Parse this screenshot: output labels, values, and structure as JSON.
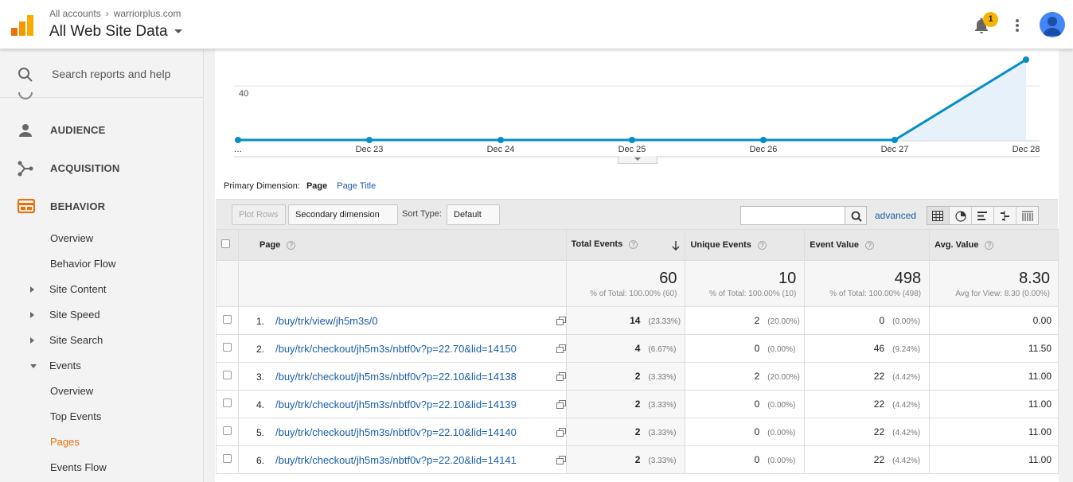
{
  "header": {
    "breadcrumb_root": "All accounts",
    "breadcrumb_account": "warriorplus.com",
    "view_title": "All Web Site Data",
    "notification_count": "1"
  },
  "sidebar": {
    "search_placeholder": "Search reports and help",
    "sections": [
      {
        "label": "AUDIENCE",
        "icon": "person-icon"
      },
      {
        "label": "ACQUISITION",
        "icon": "acquisition-icon"
      },
      {
        "label": "BEHAVIOR",
        "icon": "behavior-icon"
      }
    ],
    "behavior_items": [
      {
        "label": "Overview"
      },
      {
        "label": "Behavior Flow"
      },
      {
        "label": "Site Content"
      },
      {
        "label": "Site Speed"
      },
      {
        "label": "Site Search"
      },
      {
        "label": "Events"
      },
      {
        "label": "Overview"
      },
      {
        "label": "Top Events"
      },
      {
        "label": "Pages"
      },
      {
        "label": "Events Flow"
      }
    ],
    "accent_color": "#e8710a"
  },
  "chart_data": {
    "type": "area",
    "x": [
      "…",
      "Dec 23",
      "Dec 24",
      "Dec 25",
      "Dec 26",
      "Dec 27",
      "Dec 28"
    ],
    "series": [
      {
        "values": [
          0,
          0,
          0,
          0,
          0,
          0,
          60
        ]
      }
    ],
    "ytick": "40",
    "color": "#058dc7"
  },
  "dimension": {
    "label": "Primary Dimension:",
    "active": "Page",
    "alternate": "Page Title"
  },
  "toolbar": {
    "plot_rows": "Plot Rows",
    "secondary": "Secondary dimension",
    "sort_label": "Sort Type:",
    "sort_value": "Default",
    "advanced": "advanced"
  },
  "table": {
    "headers": [
      "Page",
      "Total Events",
      "Unique Events",
      "Event Value",
      "Avg. Value"
    ],
    "totals": [
      {
        "value": "60",
        "sub": "% of Total: 100.00% (60)"
      },
      {
        "value": "10",
        "sub": "% of Total: 100.00% (10)"
      },
      {
        "value": "498",
        "sub": "% of Total: 100.00% (498)"
      },
      {
        "value": "8.30",
        "sub": "Avg for View: 8.30 (0.00%)"
      }
    ],
    "rows": [
      {
        "idx": "1.",
        "page": "/buy/trk/view/jh5m3s/0",
        "total": "14",
        "total_pct": "(23.33%)",
        "unique": "2",
        "unique_pct": "(20.00%)",
        "value": "0",
        "value_pct": "(0.00%)",
        "avg": "0.00"
      },
      {
        "idx": "2.",
        "page": "/buy/trk/checkout/jh5m3s/nbtf0v?p=22.70&lid=14150",
        "total": "4",
        "total_pct": "(6.67%)",
        "unique": "0",
        "unique_pct": "(0.00%)",
        "value": "46",
        "value_pct": "(9.24%)",
        "avg": "11.50"
      },
      {
        "idx": "3.",
        "page": "/buy/trk/checkout/jh5m3s/nbtf0v?p=22.10&lid=14138",
        "total": "2",
        "total_pct": "(3.33%)",
        "unique": "2",
        "unique_pct": "(20.00%)",
        "value": "22",
        "value_pct": "(4.42%)",
        "avg": "11.00"
      },
      {
        "idx": "4.",
        "page": "/buy/trk/checkout/jh5m3s/nbtf0v?p=22.10&lid=14139",
        "total": "2",
        "total_pct": "(3.33%)",
        "unique": "0",
        "unique_pct": "(0.00%)",
        "value": "22",
        "value_pct": "(4.42%)",
        "avg": "11.00"
      },
      {
        "idx": "5.",
        "page": "/buy/trk/checkout/jh5m3s/nbtf0v?p=22.10&lid=14140",
        "total": "2",
        "total_pct": "(3.33%)",
        "unique": "0",
        "unique_pct": "(0.00%)",
        "value": "22",
        "value_pct": "(4.42%)",
        "avg": "11.00"
      },
      {
        "idx": "6.",
        "page": "/buy/trk/checkout/jh5m3s/nbtf0v?p=22.20&lid=14141",
        "total": "2",
        "total_pct": "(3.33%)",
        "unique": "0",
        "unique_pct": "(0.00%)",
        "value": "22",
        "value_pct": "(4.42%)",
        "avg": "11.00"
      }
    ]
  }
}
